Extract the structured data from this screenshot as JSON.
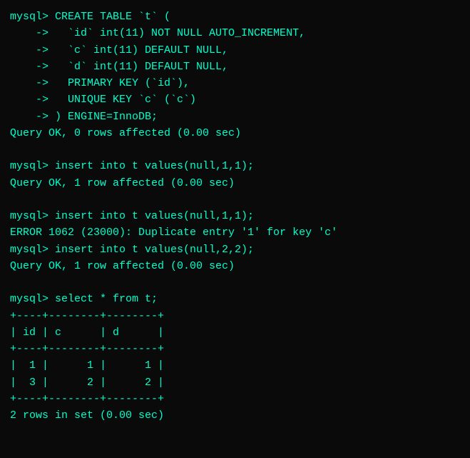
{
  "terminal": {
    "lines": [
      "mysql> CREATE TABLE `t` (",
      "    ->   `id` int(11) NOT NULL AUTO_INCREMENT,",
      "    ->   `c` int(11) DEFAULT NULL,",
      "    ->   `d` int(11) DEFAULT NULL,",
      "    ->   PRIMARY KEY (`id`),",
      "    ->   UNIQUE KEY `c` (`c`)",
      "    -> ) ENGINE=InnoDB;",
      "Query OK, 0 rows affected (0.00 sec)",
      "",
      "mysql> insert into t values(null,1,1);",
      "Query OK, 1 row affected (0.00 sec)",
      "",
      "mysql> insert into t values(null,1,1);",
      "ERROR 1062 (23000): Duplicate entry '1' for key 'c'",
      "mysql> insert into t values(null,2,2);",
      "Query OK, 1 row affected (0.00 sec)",
      "",
      "mysql> select * from t;",
      "+----+--------+--------+",
      "| id | c      | d      |",
      "+----+--------+--------+",
      "|  1 |      1 |      1 |",
      "|  3 |      2 |      2 |",
      "+----+--------+--------+",
      "2 rows in set (0.00 sec)"
    ]
  }
}
